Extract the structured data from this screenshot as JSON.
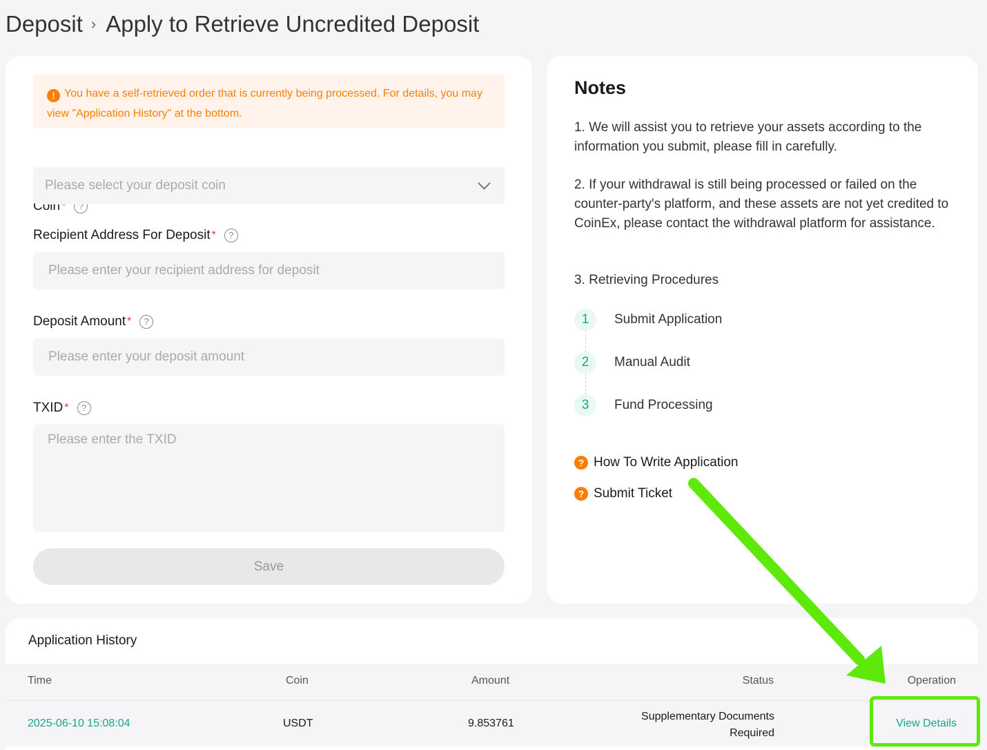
{
  "breadcrumb": {
    "root": "Deposit",
    "separator": "›",
    "current": "Apply to Retrieve Uncredited Deposit"
  },
  "alert": {
    "icon": "exclamation-icon",
    "text": "You have a self-retrieved order that is currently being processed. For details, you may view \"Application History\" at the bottom."
  },
  "form": {
    "coin": {
      "label": "Coin",
      "required": "*",
      "placeholder": "Please select your deposit coin"
    },
    "address": {
      "label": "Recipient Address For Deposit",
      "required": "*",
      "placeholder": "Please enter your recipient address for deposit"
    },
    "amount": {
      "label": "Deposit Amount",
      "required": "*",
      "placeholder": "Please enter your deposit amount"
    },
    "txid": {
      "label": "TXID",
      "required": "*",
      "placeholder": "Please enter the TXID"
    },
    "help_glyph": "?",
    "save_label": "Save"
  },
  "notes": {
    "title": "Notes",
    "items": [
      "1. We will assist you to retrieve your assets according to the information you submit, please fill in carefully.",
      "2. If your withdrawal is still being processed or failed on the counter-party's platform, and these assets are not yet credited to CoinEx, please contact the withdrawal platform for assistance.",
      "3. Retrieving Procedures"
    ],
    "steps": [
      {
        "num": "1",
        "label": "Submit Application"
      },
      {
        "num": "2",
        "label": "Manual Audit"
      },
      {
        "num": "3",
        "label": "Fund Processing"
      }
    ],
    "links": [
      {
        "icon": "question-icon",
        "label": "How To Write Application"
      },
      {
        "icon": "question-icon",
        "label": "Submit Ticket"
      }
    ]
  },
  "history": {
    "title": "Application History",
    "columns": [
      "Time",
      "Coin",
      "Amount",
      "Status",
      "Operation"
    ],
    "rows": [
      {
        "time": "2025-06-10 15:08:04",
        "coin": "USDT",
        "amount": "9.853761",
        "status": "Supplementary Documents Required",
        "operation": "View Details"
      }
    ]
  },
  "colors": {
    "accent_green": "#16a589",
    "warning_orange": "#ff7d00",
    "annotation_green": "#5ee90a"
  }
}
